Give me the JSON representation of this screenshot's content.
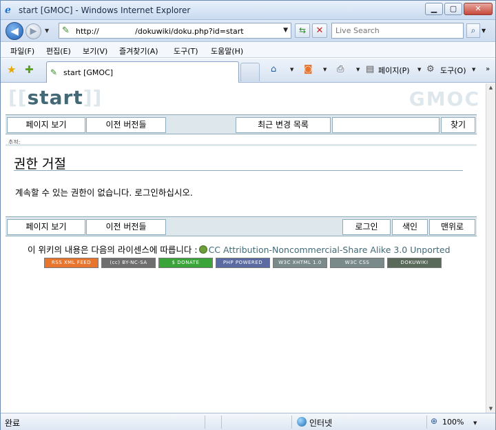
{
  "window": {
    "title": "start [GMOC] - Windows Internet Explorer",
    "min_glyph": "▁",
    "max_glyph": "▢",
    "close_glyph": "✕"
  },
  "toolbar": {
    "url": "http://               /dokuwiki/doku.php?id=start",
    "search_placeholder": "Live Search"
  },
  "menu": {
    "items": [
      "파일(F)",
      "편집(E)",
      "보기(V)",
      "즐겨찾기(A)",
      "도구(T)",
      "도움말(H)"
    ]
  },
  "tab": {
    "title": "start [GMOC]"
  },
  "commandbar": {
    "page_label": "페이지(P)",
    "tools_label": "도구(O)"
  },
  "wiki": {
    "title_open": "[[",
    "pagename": "start",
    "title_close": "]]",
    "logo": "GMOC",
    "top_buttons": {
      "show_page": "페이지 보기",
      "old_revisions": "이전 버전들",
      "recent_changes": "최근 변경 목록",
      "search": "찾기"
    },
    "breadcrumbs": "추적:",
    "heading": "권한 거절",
    "message": "계속할 수 있는 권한이 없습니다. 로그인하십시오.",
    "bottom_buttons": {
      "show_page": "페이지 보기",
      "old_revisions": "이전 버전들",
      "login": "로그인",
      "index": "색인",
      "top": "맨위로"
    },
    "license_prefix": "이 위키의 내용은 다음의 라이센스에 따릅니다 :",
    "license_link": "CC Attribution-Noncommercial-Share Alike 3.0 Unported",
    "badges": [
      {
        "text": "RSS  XML FEED",
        "color": "#e8752e"
      },
      {
        "text": "(cc) BY-NC-SA",
        "color": "#6e6e6e"
      },
      {
        "text": "$    DONATE",
        "color": "#3aa33a"
      },
      {
        "text": "PHP  POWERED",
        "color": "#5b6aa0"
      },
      {
        "text": "W3C  XHTML 1.0",
        "color": "#7a8a8a"
      },
      {
        "text": "W3C  CSS",
        "color": "#7a8a8a"
      },
      {
        "text": "DOKUWIKI",
        "color": "#5a6a5a"
      }
    ]
  },
  "status": {
    "text": "완료",
    "zone": "인터넷",
    "zoom": "100%"
  }
}
